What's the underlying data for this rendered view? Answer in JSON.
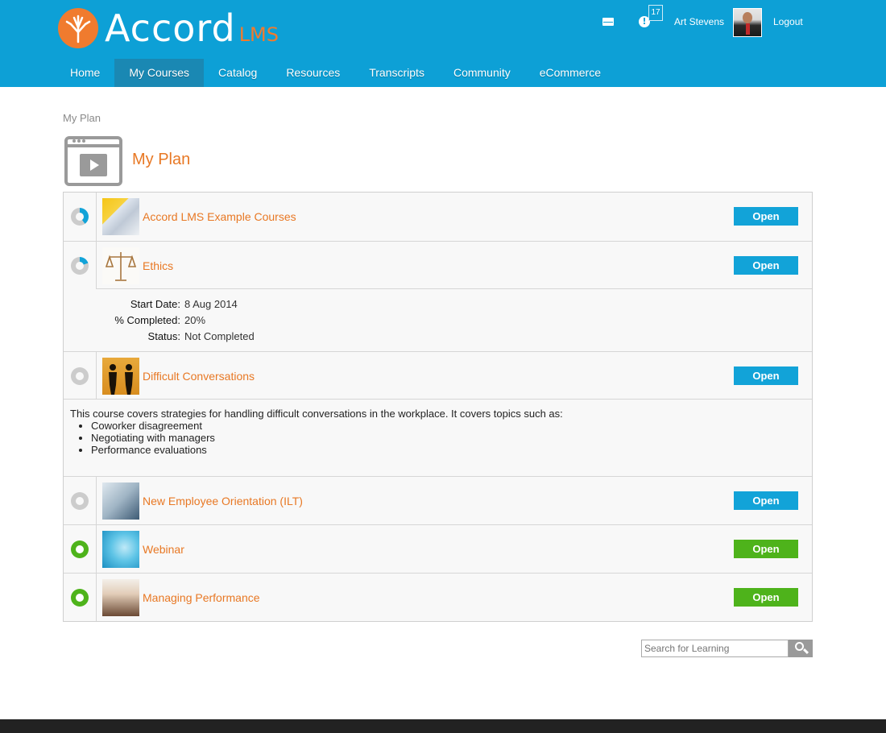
{
  "brand": {
    "name": "Accord",
    "suffix": "LMS",
    "accent_color": "#f07b2e",
    "header_color": "#0da0d6"
  },
  "topbar": {
    "alert_count": "17",
    "username": "Art Stevens",
    "logout_label": "Logout",
    "icons": [
      "mail-icon",
      "alert-icon"
    ]
  },
  "nav": {
    "items": [
      {
        "label": "Home"
      },
      {
        "label": "My Courses",
        "active": true
      },
      {
        "label": "Catalog"
      },
      {
        "label": "Resources"
      },
      {
        "label": "Transcripts"
      },
      {
        "label": "Community"
      },
      {
        "label": "eCommerce"
      }
    ]
  },
  "breadcrumb": "My Plan",
  "page_title": "My Plan",
  "plan": {
    "rows": [
      {
        "title": "Accord LMS Example Courses",
        "button": "Open",
        "status": "partial",
        "progress": 0.4
      },
      {
        "title": "Ethics",
        "button": "Open",
        "status": "partial",
        "progress": 0.2,
        "details": {
          "start_label": "Start Date:",
          "start_value": "8 Aug 2014",
          "completed_label": "% Completed:",
          "completed_value": "20%",
          "status_label": "Status:",
          "status_value": "Not Completed"
        }
      },
      {
        "title": "Difficult Conversations",
        "button": "Open",
        "status": "not-started",
        "description": {
          "text": "This course covers strategies for handling difficult conversations in the workplace.  It covers topics such as:",
          "bullets": [
            "Coworker disagreement",
            "Negotiating with managers",
            "Performance evaluations"
          ]
        }
      },
      {
        "title": "New Employee Orientation (ILT)",
        "button": "Open",
        "status": "not-started"
      },
      {
        "title": "Webinar",
        "button": "Open",
        "status": "complete"
      },
      {
        "title": "Managing Performance",
        "button": "Open",
        "status": "complete"
      }
    ]
  },
  "search": {
    "placeholder": "Search for Learning"
  },
  "colors": {
    "title_orange": "#e87824",
    "button_blue": "#12a3d8",
    "button_green": "#4eb31b",
    "ring_gray": "#cccccc",
    "ring_blue": "#12a3d8"
  }
}
